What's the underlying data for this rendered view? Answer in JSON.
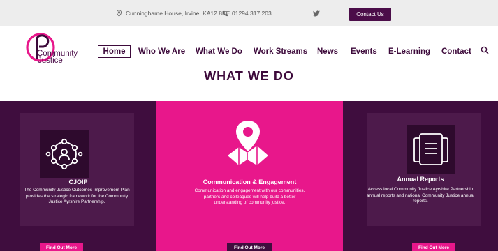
{
  "topbar": {
    "address": "Cunninghame House, Irvine, KA12 8EE",
    "phone": "01294 317 203",
    "contact_button": "Contact Us"
  },
  "logo": {
    "line1": "Community",
    "line2": "Justice"
  },
  "nav": {
    "items": [
      "Home",
      "Who We Are",
      "What We Do",
      "Work Streams",
      "News",
      "Events",
      "E-Learning",
      "Contact"
    ],
    "active": "Home"
  },
  "page_title": "WHAT WE DO",
  "panels": [
    {
      "title": "CJOIP",
      "description": "The Community Justice Outcomes Improvement Plan provides the strategic framework for the Community Justice Ayrshire Partnership.",
      "button": "Find Out More",
      "icon": "network-people-icon"
    },
    {
      "title": "Communication & Engagement",
      "description": "Communication and engagement with our communities, partners and colleagues will help build a better understanding of community justice.",
      "button": "Find Out More",
      "icon": "map-pin-icon"
    },
    {
      "title": "Annual Reports",
      "description": "Access local Community Justice Ayrshire Partnership annual reports and national Community Justice annual reports.",
      "button": "Find Out More",
      "icon": "documents-icon"
    }
  ],
  "colors": {
    "brand_purple": "#3f0d3e",
    "brand_pink": "#e8178b",
    "topbar_bg": "#ededed"
  }
}
